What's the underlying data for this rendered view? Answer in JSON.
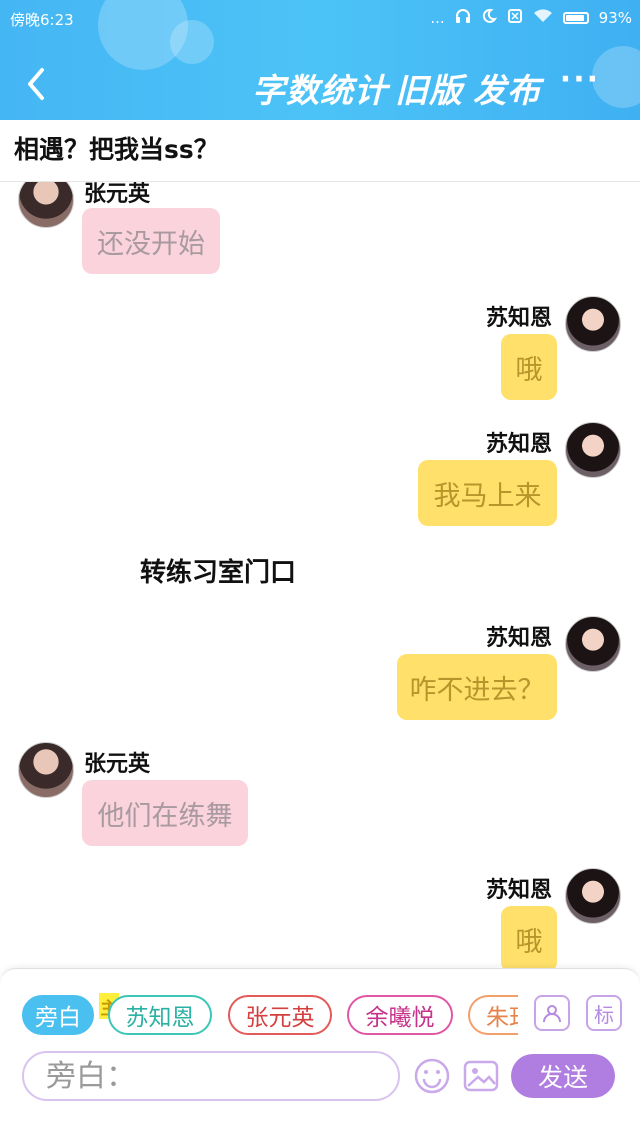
{
  "status_bar": {
    "time": "傍晚6:23",
    "dots": "...",
    "battery": "93%"
  },
  "header": {
    "tabs": [
      "字数统计",
      "旧版",
      "发布"
    ],
    "more": "···"
  },
  "subtitle": "相遇？把我当ss？",
  "chat": {
    "messages": [
      {
        "side": "left",
        "name": "张元英",
        "text": "还没开始"
      },
      {
        "side": "right",
        "name": "苏知恩",
        "text": "哦"
      },
      {
        "side": "right",
        "name": "苏知恩",
        "text": "我马上来"
      },
      {
        "side": "narration",
        "text": "转练习室门口"
      },
      {
        "side": "right",
        "name": "苏知恩",
        "text": "咋不进去？"
      },
      {
        "side": "left",
        "name": "张元英",
        "text": "他们在练舞"
      },
      {
        "side": "right",
        "name": "苏知恩",
        "text": "哦"
      }
    ]
  },
  "composer": {
    "roles": [
      "旁白",
      "苏知恩",
      "张元英",
      "余曦悦",
      "朱珏"
    ],
    "main_badge": "主",
    "mark_label": "标",
    "input_placeholder": "旁白：",
    "send_label": "发送"
  },
  "colors": {
    "header": "#45b6f4",
    "pink_bubble": "#fbd3dc",
    "yellow_bubble": "#ffe06b",
    "send": "#b07de0"
  }
}
